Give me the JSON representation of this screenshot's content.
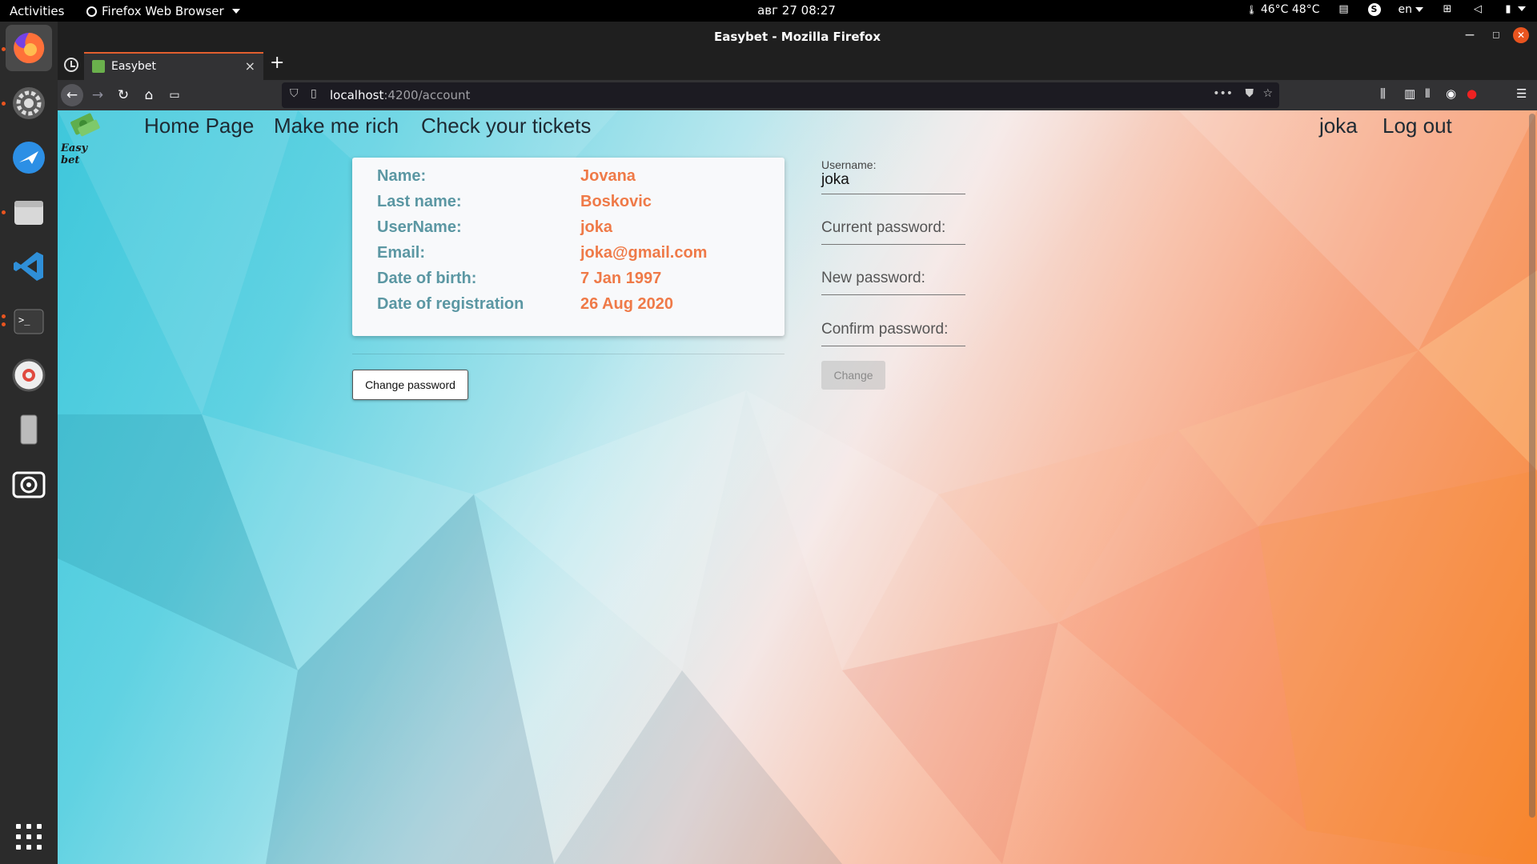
{
  "topbar": {
    "activities": "Activities",
    "app_menu": "Firefox Web Browser",
    "clock": "авг 27  08:27",
    "temperature": "46°C 48°C",
    "lang": "en",
    "skype": "S"
  },
  "dock": {
    "items": [
      "firefox-icon",
      "settings-icon",
      "app-icon",
      "files-icon",
      "vscode-icon",
      "terminal-icon",
      "help-icon",
      "device-icon",
      "camera-icon"
    ]
  },
  "window": {
    "title": "Easybet - Mozilla Firefox"
  },
  "tabs": {
    "active_title": "Easybet",
    "close": "×",
    "new_tab": "+"
  },
  "nav": {
    "url_host": "localhost",
    "url_path": ":4200/account",
    "dots": "•••"
  },
  "site": {
    "logo_text": "Easy bet",
    "links": {
      "home": "Home Page",
      "rich": "Make me rich",
      "tickets": "Check your tickets",
      "user": "joka",
      "logout": "Log out"
    }
  },
  "profile": {
    "rows": [
      {
        "label": "Name:",
        "value": "Jovana"
      },
      {
        "label": "Last name:",
        "value": "Boskovic"
      },
      {
        "label": "UserName:",
        "value": "joka"
      },
      {
        "label": "Email:",
        "value": "joka@gmail.com"
      },
      {
        "label": "Date of birth:",
        "value": "7 Jan 1997"
      },
      {
        "label": "Date of registration",
        "value": "26 Aug 2020"
      }
    ],
    "change_password_button": "Change password"
  },
  "form": {
    "username_label": "Username:",
    "username_value": "joka",
    "current_password_placeholder": "Current password:",
    "new_password_placeholder": "New password:",
    "confirm_password_placeholder": "Confirm password:",
    "submit_label": "Change"
  },
  "colors": {
    "label": "#5b97a3",
    "value": "#ef7a48",
    "firefox_accent": "#e35f2f"
  }
}
